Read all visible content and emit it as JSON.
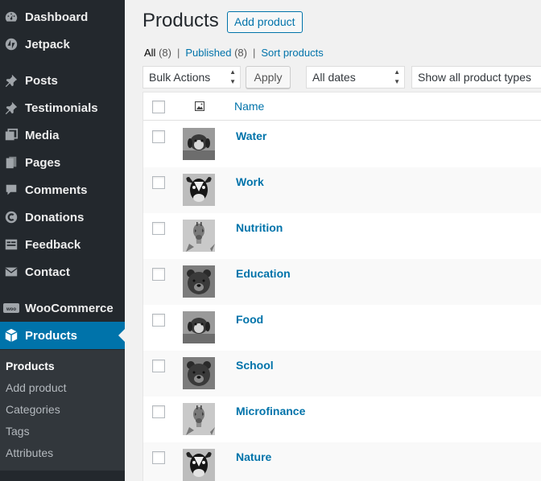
{
  "sidebar": {
    "items": [
      {
        "label": "Dashboard",
        "icon": "dashboard-icon"
      },
      {
        "label": "Jetpack",
        "icon": "jetpack-icon"
      },
      {
        "label": "Posts",
        "icon": "pin-icon"
      },
      {
        "label": "Testimonials",
        "icon": "pin-icon"
      },
      {
        "label": "Media",
        "icon": "media-icon"
      },
      {
        "label": "Pages",
        "icon": "pages-icon"
      },
      {
        "label": "Comments",
        "icon": "comment-icon"
      },
      {
        "label": "Donations",
        "icon": "donation-icon"
      },
      {
        "label": "Feedback",
        "icon": "feedback-icon"
      },
      {
        "label": "Contact",
        "icon": "mail-icon"
      },
      {
        "label": "WooCommerce",
        "icon": "woo-icon"
      },
      {
        "label": "Products",
        "icon": "box-icon",
        "active": true
      }
    ],
    "submenu": [
      {
        "label": "Products",
        "current": true
      },
      {
        "label": "Add product"
      },
      {
        "label": "Categories"
      },
      {
        "label": "Tags"
      },
      {
        "label": "Attributes"
      }
    ]
  },
  "header": {
    "title": "Products",
    "add_button": "Add product"
  },
  "filters": {
    "all_label": "All",
    "all_count": "(8)",
    "published_label": "Published",
    "published_count": "(8)",
    "sort_label": "Sort products",
    "separator": "|"
  },
  "toolbar": {
    "bulk_actions": "Bulk Actions",
    "apply": "Apply",
    "dates": "All dates",
    "product_types": "Show all product types"
  },
  "table": {
    "column_name": "Name",
    "rows": [
      {
        "name": "Water",
        "image": "dog"
      },
      {
        "name": "Work",
        "image": "cow"
      },
      {
        "name": "Nutrition",
        "image": "giraffe"
      },
      {
        "name": "Education",
        "image": "bear"
      },
      {
        "name": "Food",
        "image": "dog"
      },
      {
        "name": "School",
        "image": "bear"
      },
      {
        "name": "Microfinance",
        "image": "giraffe"
      },
      {
        "name": "Nature",
        "image": "cow"
      }
    ]
  },
  "colors": {
    "sidebar_bg": "#23282d",
    "active_bg": "#0073aa",
    "link": "#0073aa"
  }
}
